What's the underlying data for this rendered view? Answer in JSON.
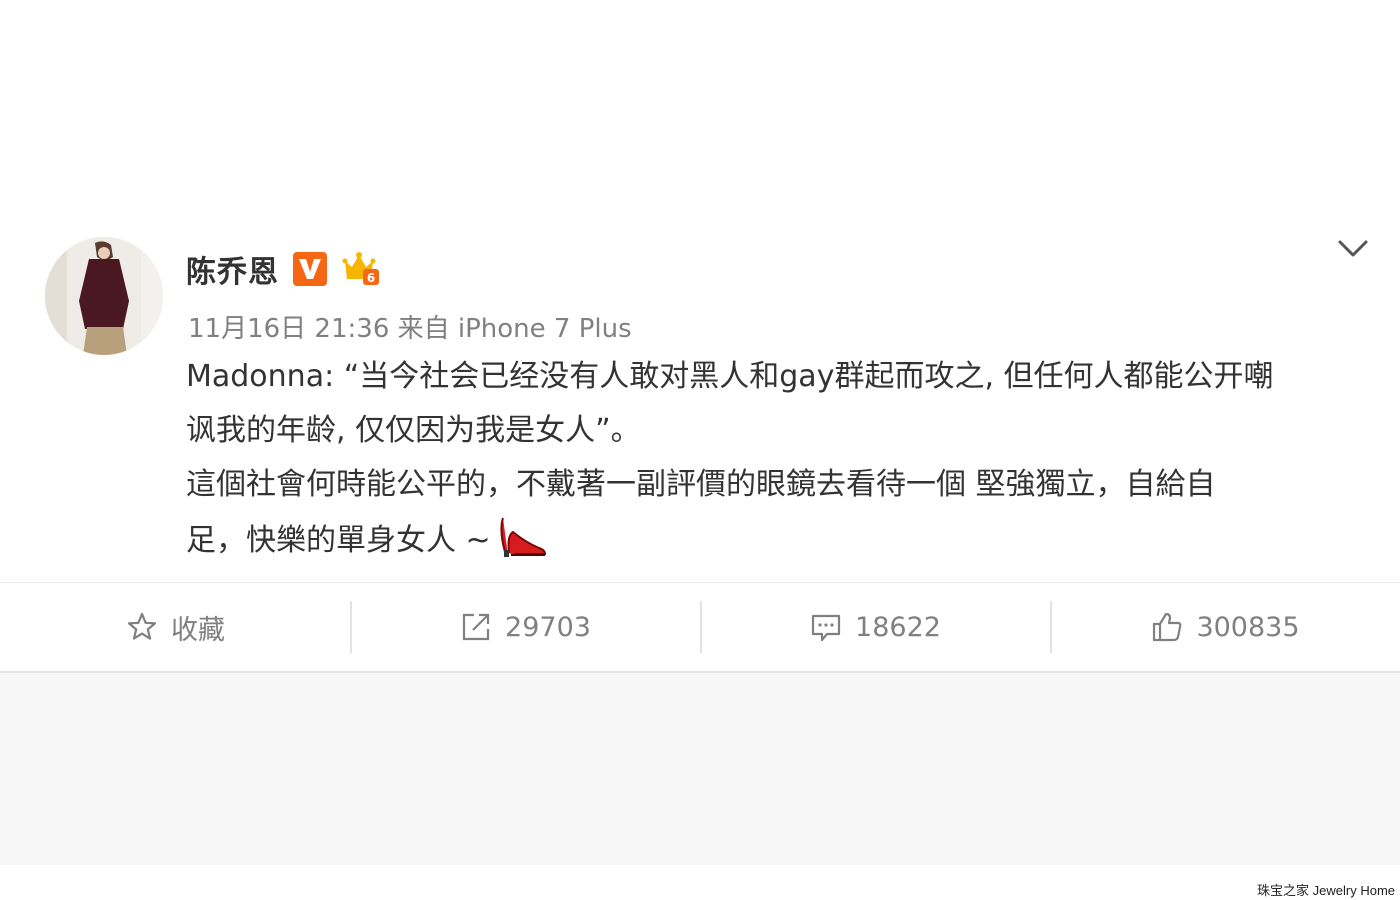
{
  "user": {
    "name": "陈乔恩"
  },
  "post": {
    "meta": "11月16日 21:36 来自 iPhone 7 Plus",
    "lines": [
      "Madonna: “当今社会已经没有人敢对黑人和gay群起而攻之, 但任何人都能公开嘲",
      "讽我的年龄, 仅仅因为我是女人”。",
      "這個社會何時能公平的，不戴著一副評價的眼鏡去看待一個 堅強獨立，自給自",
      "足，快樂的單身女人 ~"
    ]
  },
  "actions": {
    "favorite": "收藏",
    "repost": "29703",
    "comment": "18622",
    "like": "300835"
  },
  "icons": {
    "verified": "verified-v-icon",
    "member": "crown-member-icon",
    "more": "chevron-down-icon",
    "favorite": "star-icon",
    "repost": "share-arrow-icon",
    "comment": "comment-bubble-icon",
    "like": "thumbs-up-icon",
    "emoji": "high-heel-icon"
  },
  "colors": {
    "verified_badge": "#f56714",
    "crown": "#f7b500",
    "text": "#333333",
    "meta": "#808080"
  },
  "watermark": "珠宝之家 Jewelry Home"
}
